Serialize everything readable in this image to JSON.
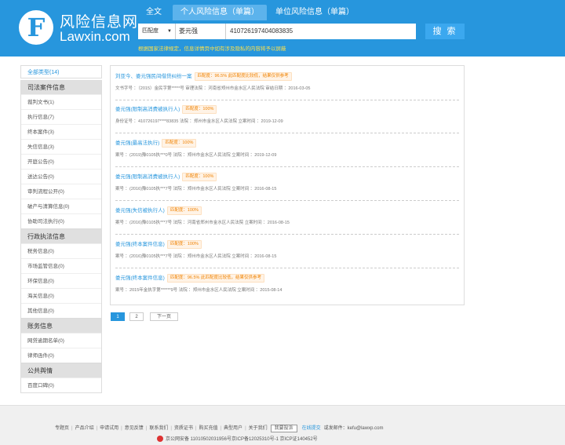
{
  "brand": {
    "logo_letter": "F",
    "name_cn": "风险信息网",
    "name_en": "Lawxin.com"
  },
  "tabs": [
    "全文",
    "个人风险信息（单篇）",
    "单位风险信息（单篇）"
  ],
  "search": {
    "mode": "匹配度",
    "name_value": "娄元强",
    "id_value": "410726197404083835",
    "button": "搜 索",
    "notice": "根据国家法律规定，信息详情页中如有涉及隐私的内容将予以屏蔽"
  },
  "sidebar": {
    "all": "全部类型(14)",
    "groups": [
      {
        "title": "司法案件信息",
        "items": [
          "裁判文书(1)",
          "执行信息(7)",
          "终本案件(3)",
          "失信信息(3)",
          "开庭公告(0)",
          "送达公告(0)",
          "审判流程公开(0)",
          "破产与清算信息(0)",
          "协助司法执行(0)"
        ]
      },
      {
        "title": "行政执法信息",
        "items": [
          "税务信息(0)",
          "市场监管信息(0)",
          "环保信息(0)",
          "海关信息(0)",
          "其他信息(0)"
        ]
      },
      {
        "title": "账务信息",
        "items": [
          "网贷逾期名单(0)",
          "律师函件(0)"
        ]
      },
      {
        "title": "公共舆情",
        "items": [
          "百度口碑(0)"
        ]
      }
    ]
  },
  "results": [
    {
      "title": "刘亚今、娄元强民间借贷纠纷一案",
      "match": "匹配度：96.5% 此匹配度比较低，结果仅供参考",
      "meta": "文书字号 ：（2015）金民字第*****号  审理法院 ：河南省郑州市金水区人民法院  审结日期 ：2016-03-05"
    },
    {
      "title": "娄元强(限制高消费被执行人)",
      "match": "匹配度：100%",
      "meta": "身份证号 ：410726197****83835  法院 ：郑州市金水区人民法院    立案时间 ：2019-12-09"
    },
    {
      "title": "娄元强(最高法执行)",
      "match": "匹配度：100%",
      "meta": "案号 ：(2019)豫0105执***0号  法院 ：郑州市金水区人民法院    立案时间 ：2019-12-09"
    },
    {
      "title": "娄元强(限制高消费被执行人)",
      "match": "匹配度：100%",
      "meta": "案号 ：(2016)豫0105执***7号  法院 ：郑州市金水区人民法院    立案时间 ：2016-08-15"
    },
    {
      "title": "娄元强(失信被执行人)",
      "match": "匹配度：100%",
      "meta": "案号 ：(2016)豫0105执***7号  法院 ：河南省郑州市金水区人民法院    立案时间 ：2016-08-15"
    },
    {
      "title": "娄元强(终本案件信息)",
      "match": "匹配度：100%",
      "meta": "案号 ：(2016)豫0105执***7号  法院 ：郑州市金水区人民法院    立案时间 ：2016-08-15"
    },
    {
      "title": "娄元强(终本案件信息)",
      "match": "匹配度：96.5% 此匹配度比较低，结果仅供参考",
      "meta": "案号 ：2015年金执字第******9号  法院 ：郑州市金水区人民法院    立案时间 ：2015-08-14"
    }
  ],
  "pager": {
    "p1": "1",
    "p2": "2",
    "next": "下一页"
  },
  "footer": {
    "links": [
      "专题页",
      "产品介绍",
      "申请试用",
      "意见反馈",
      "联系我们",
      "资质证书",
      "购买充值",
      "典型用户",
      "关于我们"
    ],
    "report": "我要投诉",
    "online": "在线提交",
    "email": "或发邮件：kefu@lawxp.com",
    "icp": "京公网安备 11010502031956号京ICP备12025310号-1 京ICP证140452号"
  }
}
